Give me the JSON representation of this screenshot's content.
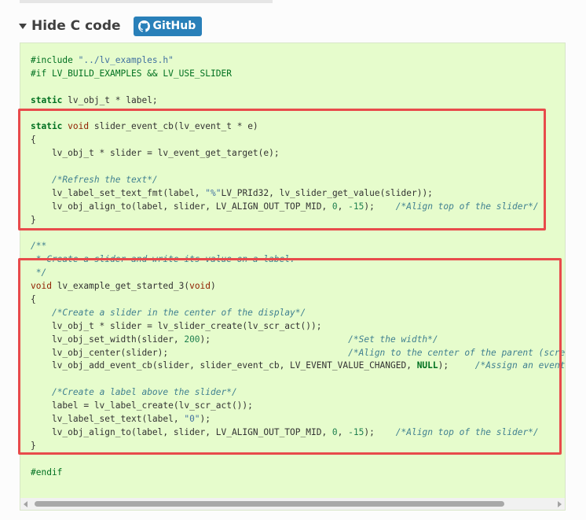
{
  "header": {
    "toggle_label": "Hide C code",
    "github_label": "GitHub"
  },
  "code_lines": [
    [
      [
        "pp",
        "#include "
      ],
      [
        "str",
        "\"../lv_examples.h\""
      ]
    ],
    [
      [
        "pp",
        "#if LV_BUILD_EXAMPLES && LV_USE_SLIDER"
      ]
    ],
    [],
    [
      [
        "kw",
        "static"
      ],
      [
        "t",
        " lv_obj_t * label;"
      ]
    ],
    [],
    [
      [
        "kw",
        "static"
      ],
      [
        "t",
        " "
      ],
      [
        "typ",
        "void"
      ],
      [
        "t",
        " slider_event_cb(lv_event_t * e)"
      ]
    ],
    [
      [
        "t",
        "{"
      ]
    ],
    [
      [
        "t",
        "    lv_obj_t * slider = lv_event_get_target(e);"
      ]
    ],
    [],
    [
      [
        "t",
        "    "
      ],
      [
        "com",
        "/*Refresh the text*/"
      ]
    ],
    [
      [
        "t",
        "    lv_label_set_text_fmt(label, "
      ],
      [
        "str",
        "\"%\""
      ],
      [
        "t",
        "LV_PRId32, lv_slider_get_value(slider));"
      ]
    ],
    [
      [
        "t",
        "    lv_obj_align_to(label, slider, LV_ALIGN_OUT_TOP_MID, "
      ],
      [
        "num",
        "0"
      ],
      [
        "t",
        ", "
      ],
      [
        "num",
        "-15"
      ],
      [
        "t",
        ");    "
      ],
      [
        "com",
        "/*Align top of the slider*/"
      ]
    ],
    [
      [
        "t",
        "}"
      ]
    ],
    [],
    [
      [
        "com",
        "/**"
      ]
    ],
    [
      [
        "com",
        " * Create a slider and write its value on a label."
      ]
    ],
    [
      [
        "com",
        " */"
      ]
    ],
    [
      [
        "typ",
        "void"
      ],
      [
        "t",
        " lv_example_get_started_3("
      ],
      [
        "typ",
        "void"
      ],
      [
        "t",
        ")"
      ]
    ],
    [
      [
        "t",
        "{"
      ]
    ],
    [
      [
        "t",
        "    "
      ],
      [
        "com",
        "/*Create a slider in the center of the display*/"
      ]
    ],
    [
      [
        "t",
        "    lv_obj_t * slider = lv_slider_create(lv_scr_act());"
      ]
    ],
    [
      [
        "t",
        "    lv_obj_set_width(slider, "
      ],
      [
        "num",
        "200"
      ],
      [
        "t",
        ");                          "
      ],
      [
        "com",
        "/*Set the width*/"
      ]
    ],
    [
      [
        "t",
        "    lv_obj_center(slider);                                  "
      ],
      [
        "com",
        "/*Align to the center of the parent (screen)*/"
      ]
    ],
    [
      [
        "t",
        "    lv_obj_add_event_cb(slider, slider_event_cb, LV_EVENT_VALUE_CHANGED, "
      ],
      [
        "kw",
        "NULL"
      ],
      [
        "t",
        ");     "
      ],
      [
        "com",
        "/*Assign an event function*/"
      ]
    ],
    [],
    [
      [
        "t",
        "    "
      ],
      [
        "com",
        "/*Create a label above the slider*/"
      ]
    ],
    [
      [
        "t",
        "    label = lv_label_create(lv_scr_act());"
      ]
    ],
    [
      [
        "t",
        "    lv_label_set_text(label, "
      ],
      [
        "str",
        "\"0\""
      ],
      [
        "t",
        ");"
      ]
    ],
    [
      [
        "t",
        "    lv_obj_align_to(label, slider, LV_ALIGN_OUT_TOP_MID, "
      ],
      [
        "num",
        "0"
      ],
      [
        "t",
        ", "
      ],
      [
        "num",
        "-15"
      ],
      [
        "t",
        ");    "
      ],
      [
        "com",
        "/*Align top of the slider*/"
      ]
    ],
    [
      [
        "t",
        "}"
      ]
    ],
    [],
    [
      [
        "pp",
        "#endif"
      ]
    ]
  ],
  "colors": {
    "code_background": "#e6fccc",
    "highlight_border": "#e84b4b",
    "github_button": "#2980b9"
  },
  "icons": {
    "toggle": "caret-down-icon",
    "github": "github-icon"
  }
}
